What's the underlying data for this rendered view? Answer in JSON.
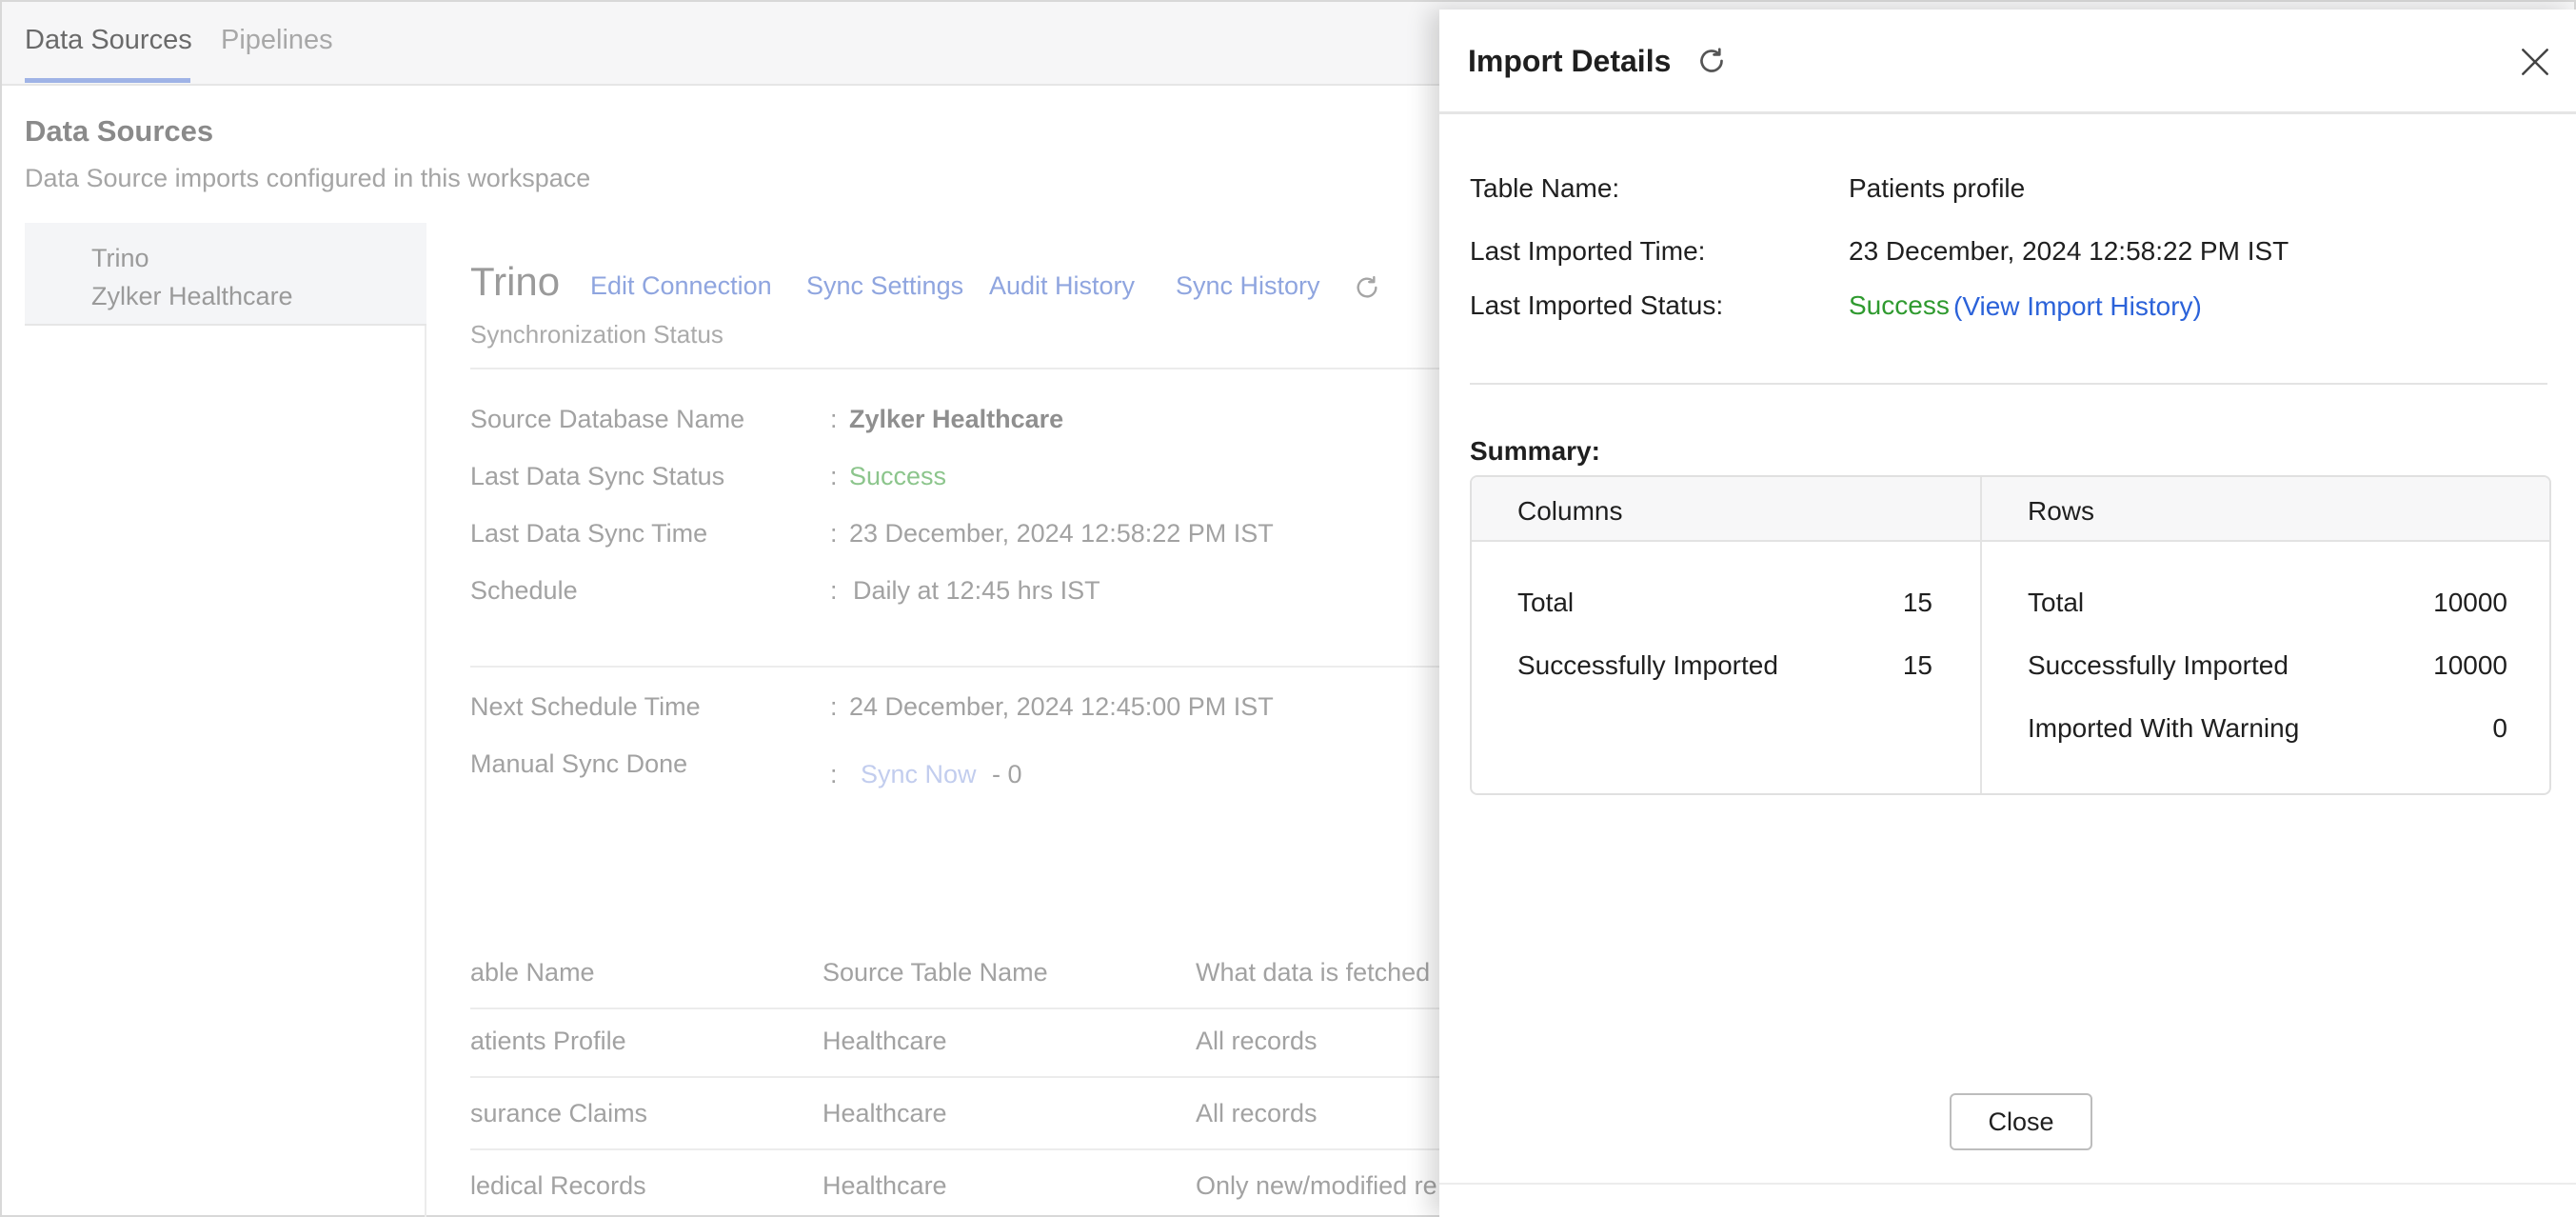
{
  "topnav": {
    "tabs": [
      {
        "label": "Data Sources",
        "active": true
      },
      {
        "label": "Pipelines",
        "active": false
      }
    ]
  },
  "section": {
    "title": "Data Sources",
    "subtitle": "Data Source imports configured in this workspace"
  },
  "sources": [
    {
      "line1": "Trino",
      "line2": "Zylker Healthcare"
    }
  ],
  "connection": {
    "title": "Trino",
    "links": [
      "Edit Connection",
      "Sync Settings",
      "Audit History",
      "Sync History"
    ],
    "sync_status_label": "Synchronization Status"
  },
  "info": {
    "rows": [
      {
        "label": "Source Database Name",
        "value": "Zylker Healthcare"
      },
      {
        "label": "Last Data Sync Status",
        "value": "Success"
      },
      {
        "label": "Last Data Sync Time",
        "value": "23 December, 2024 12:58:22 PM IST"
      },
      {
        "label": "Schedule",
        "value": "Daily at 12:45 hrs IST"
      },
      {
        "label": "Next Schedule Time",
        "value": "24 December, 2024 12:45:00 PM IST"
      },
      {
        "label": "Manual Sync Done",
        "value": ""
      }
    ],
    "colon": ":",
    "sync_now": "Sync Now",
    "sync_now_count": "- 0"
  },
  "tables": {
    "headers": [
      "able Name",
      "Source Table Name",
      "What data is fetched"
    ],
    "rows": [
      [
        "atients Profile",
        "Healthcare",
        "All records"
      ],
      [
        "surance Claims",
        "Healthcare",
        "All records"
      ],
      [
        "ledical Records",
        "Healthcare",
        "Only new/modified re"
      ]
    ]
  },
  "panel": {
    "title": "Import Details",
    "details": [
      {
        "label": "Table Name:",
        "value": "Patients profile"
      },
      {
        "label": "Last Imported Time:",
        "value": "23 December, 2024 12:58:22 PM IST"
      },
      {
        "label": "Last Imported Status:",
        "value": "Success"
      }
    ],
    "history_link": "(View Import History)",
    "summary_label": "Summary:",
    "columns": {
      "header": "Columns",
      "rows": [
        {
          "label": "Total",
          "value": "15"
        },
        {
          "label": "Successfully Imported",
          "value": "15"
        }
      ]
    },
    "rows": {
      "header": "Rows",
      "rows": [
        {
          "label": "Total",
          "value": "10000"
        },
        {
          "label": "Successfully Imported",
          "value": "10000"
        },
        {
          "label": "Imported With Warning",
          "value": "0"
        }
      ]
    },
    "close_label": "Close"
  }
}
